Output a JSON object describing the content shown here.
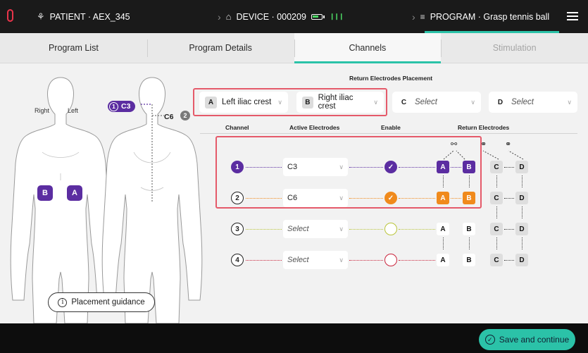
{
  "topbar": {
    "patient": "PATIENT · AEX_345",
    "device": "DEVICE · 000209",
    "program": "PROGRAM · Grasp tennis ball"
  },
  "tabs": [
    {
      "label": "Program List",
      "state": "normal"
    },
    {
      "label": "Program Details",
      "state": "normal"
    },
    {
      "label": "Channels",
      "state": "active"
    },
    {
      "label": "Stimulation",
      "state": "disabled"
    }
  ],
  "figure": {
    "right_label": "Right",
    "left_label": "Left",
    "badge_b": "B",
    "badge_a": "A",
    "c3_num": "1",
    "c3_label": "C3",
    "c6_label": "C6",
    "c6_num": "2",
    "guidance_label": "Placement guidance"
  },
  "return_placement": {
    "title": "Return Electrodes Placement",
    "selects": [
      {
        "letter": "A",
        "value": "Left iliac crest",
        "placeholder": false
      },
      {
        "letter": "B",
        "value": "Right iliac crest",
        "placeholder": false
      },
      {
        "letter": "C",
        "value": "Select",
        "placeholder": true
      },
      {
        "letter": "D",
        "value": "Select",
        "placeholder": true
      }
    ]
  },
  "columns": {
    "channel": "Channel",
    "active": "Active Electrodes",
    "enable": "Enable",
    "return": "Return Electrodes"
  },
  "channels": [
    {
      "num": "1",
      "electrode": "C3",
      "placeholder": false,
      "color": "#5b2da1",
      "enabled": true,
      "ret": [
        "A",
        "B",
        "C",
        "D"
      ]
    },
    {
      "num": "2",
      "electrode": "C6",
      "placeholder": false,
      "color": "#f08a1c",
      "enabled": true,
      "ret": [
        "A",
        "B",
        "C",
        "D"
      ]
    },
    {
      "num": "3",
      "electrode": "Select",
      "placeholder": true,
      "color": "#b9c53a",
      "enabled": false,
      "ret": [
        "A",
        "B",
        "C",
        "D"
      ]
    },
    {
      "num": "4",
      "electrode": "Select",
      "placeholder": true,
      "color": "#c9243c",
      "enabled": false,
      "ret": [
        "A",
        "B",
        "C",
        "D"
      ]
    }
  ],
  "footer": {
    "save_label": "Save and continue"
  },
  "colors": {
    "accent": "#2bc2a8",
    "channel1": "#5b2da1",
    "channel2": "#f08a1c",
    "highlight": "#e55a6a"
  }
}
